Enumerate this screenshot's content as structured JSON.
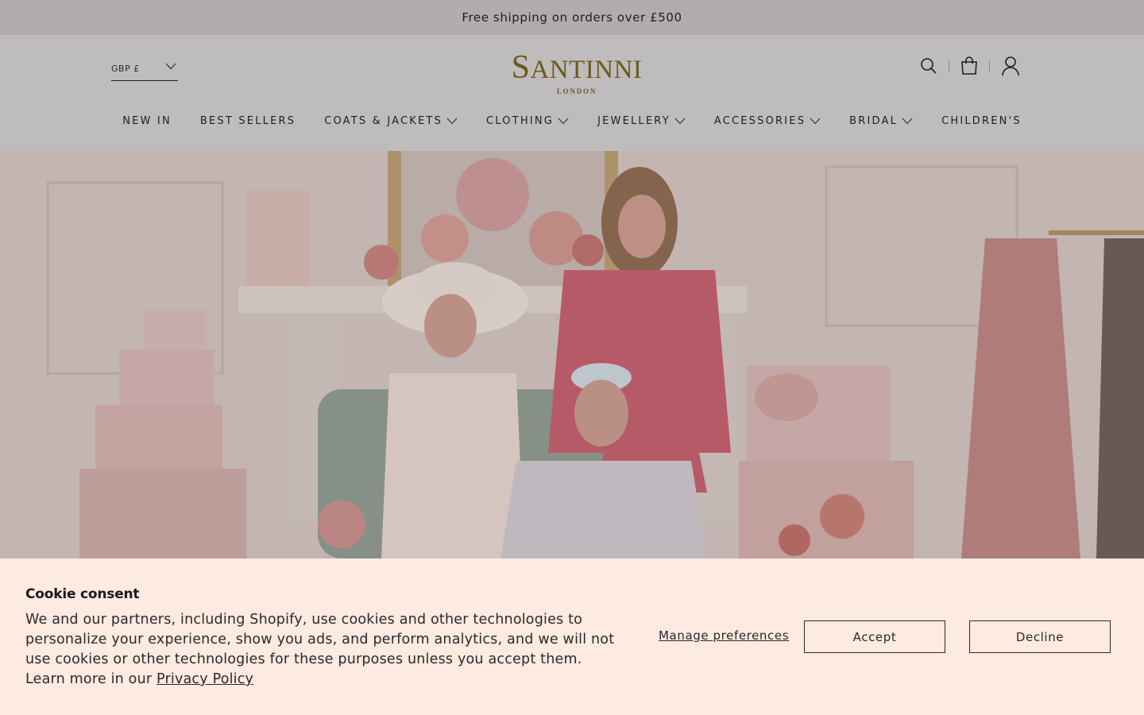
{
  "announcement": "Free shipping on orders over £500",
  "currency": {
    "value": "GBP £"
  },
  "logo": {
    "main_first": "S",
    "main_rest": "ANTINNI",
    "sub": "LONDON"
  },
  "header_icons": [
    "search-icon",
    "bag-icon",
    "account-icon"
  ],
  "nav": [
    {
      "label": "NEW IN",
      "dropdown": false
    },
    {
      "label": "BEST SELLERS",
      "dropdown": false
    },
    {
      "label": "COATS & JACKETS",
      "dropdown": true
    },
    {
      "label": "CLOTHING",
      "dropdown": true
    },
    {
      "label": "JEWELLERY",
      "dropdown": true
    },
    {
      "label": "ACCESSORIES",
      "dropdown": true
    },
    {
      "label": "BRIDAL",
      "dropdown": true
    },
    {
      "label": "CHILDREN'S",
      "dropdown": false
    }
  ],
  "cookie": {
    "title": "Cookie consent",
    "text": "We and our partners, including Shopify, use cookies and other technologies to personalize your experience, show you ads, and perform analytics, and we will not use cookies or other technologies for these purposes unless you accept them. Learn more in our ",
    "privacy_link": "Privacy Policy",
    "manage": "Manage preferences",
    "accept": "Accept",
    "decline": "Decline"
  },
  "colors": {
    "announcement_bg": "#b2abaf",
    "header_bg": "#bfbcbe",
    "logo": "#6b5a1c",
    "cookie_bg": "#fdeae1"
  }
}
